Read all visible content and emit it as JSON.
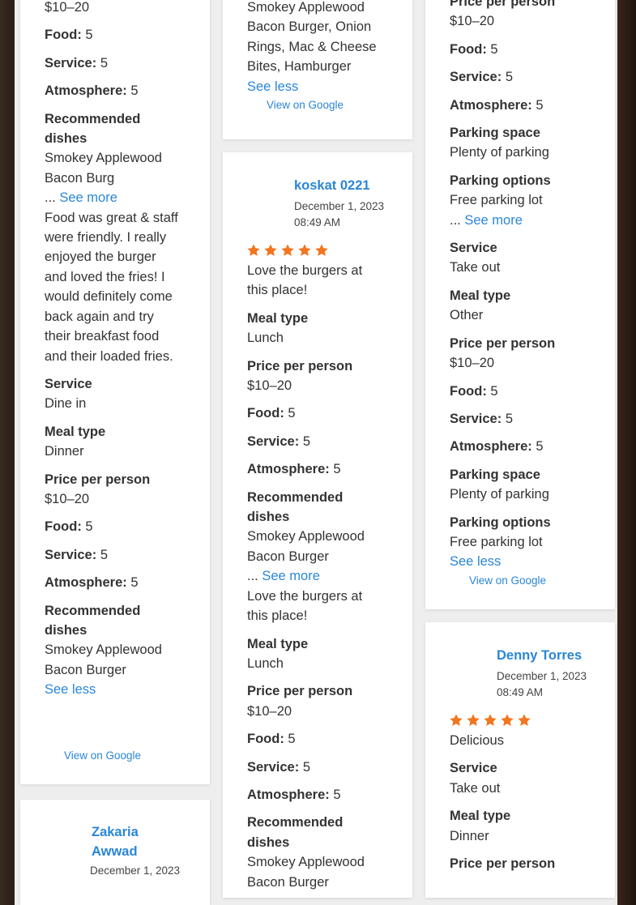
{
  "colors": {
    "link": "#2a86d6",
    "star": "#f2751f",
    "label": "#333333"
  },
  "labels": {
    "food": "Food:",
    "service": "Service:",
    "atmosphere": "Atmosphere:",
    "recommended": "Recommended dishes",
    "service_type": "Service",
    "meal_type": "Meal type",
    "price": "Price per person",
    "parking_space": "Parking space",
    "parking_options": "Parking options",
    "see_more": "See more",
    "see_less": "See less",
    "ellipsis": "...",
    "view_google": "View on Google"
  },
  "col1": {
    "top_price": "$10–20",
    "food": "5",
    "service": "5",
    "atmosphere": "5",
    "rec_lines": [
      "Smokey Applewood",
      "Bacon Burg"
    ],
    "text_lines": [
      "Food was great & staff",
      "were friendly. I really",
      "enjoyed the burger",
      "and loved the fries! I",
      "would definitely come",
      "back again and try",
      "their breakfast food",
      "and their loaded fries."
    ],
    "service_type": "Dine in",
    "meal_type": "Dinner",
    "price": "$10–20",
    "food2": "5",
    "service2": "5",
    "atmosphere2": "5",
    "rec2_lines": [
      "Smokey Applewood",
      "Bacon Burger"
    ],
    "next_review": {
      "name_lines": [
        "Zakaria",
        "Awwad"
      ],
      "date": "December 1, 2023"
    }
  },
  "col2": {
    "top_lines": [
      "Smokey Applewood",
      "Bacon Burger, Onion",
      "Rings, Mac & Cheese",
      "Bites, Hamburger"
    ],
    "review": {
      "name": "koskat 0221",
      "date": "December 1, 2023",
      "time": "08:49 AM",
      "rating": 5,
      "text_lines": [
        "Love the burgers at",
        "this place!"
      ],
      "meal_type": "Lunch",
      "price": "$10–20",
      "food": "5",
      "service": "5",
      "atmosphere": "5",
      "rec_lines": [
        "Smokey Applewood",
        "Bacon Burger"
      ],
      "full_text_lines": [
        "Love the burgers at",
        "this place!"
      ],
      "meal_type2": "Lunch",
      "price2": "$10–20",
      "food2": "5",
      "service2": "5",
      "atmosphere2": "5",
      "rec2_lines": [
        "Smokey Applewood",
        "Bacon Burger"
      ]
    }
  },
  "col3": {
    "top_price": "$10–20",
    "food": "5",
    "service": "5",
    "atmosphere": "5",
    "parking_space": "Plenty of parking",
    "parking_options": "Free parking lot",
    "service_type": "Take out",
    "meal_type": "Other",
    "price": "$10–20",
    "food2": "5",
    "service2": "5",
    "atmosphere2": "5",
    "parking_space2": "Plenty of parking",
    "parking_options2": "Free parking lot",
    "review": {
      "name": "Denny Torres",
      "date": "December 1, 2023",
      "time": "08:49 AM",
      "rating": 5,
      "text": "Delicious",
      "service_type": "Take out",
      "meal_type": "Dinner"
    }
  }
}
